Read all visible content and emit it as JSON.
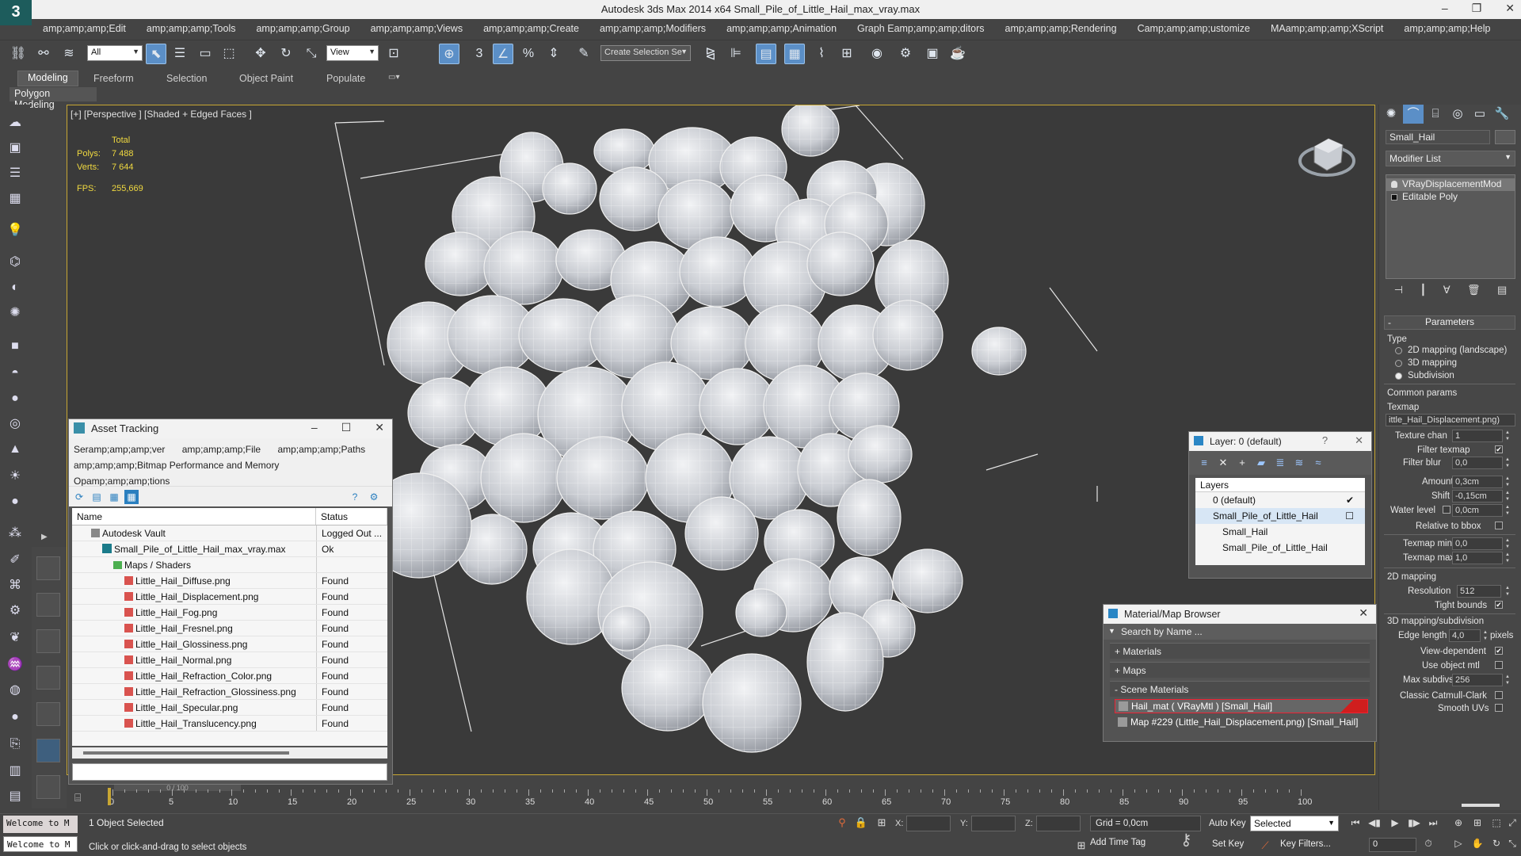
{
  "app": {
    "logo": "3",
    "title": "Autodesk 3ds Max  2014 x64     Small_Pile_of_Little_Hail_max_vray.max"
  },
  "menu": [
    "amp;amp;amp;Edit",
    "amp;amp;amp;Tools",
    "amp;amp;amp;Group",
    "amp;amp;amp;Views",
    "amp;amp;amp;Create",
    "amp;amp;amp;Modifiers",
    "amp;amp;amp;Animation",
    "Graph Eamp;amp;amp;ditors",
    "amp;amp;amp;Rendering",
    "Camp;amp;amp;ustomize",
    "MAamp;amp;amp;XScript",
    "amp;amp;amp;Help"
  ],
  "toolbar": {
    "filter": "All",
    "refcoord": "View",
    "selection_set": "Create Selection Se"
  },
  "ribbon": {
    "tabs": [
      "Modeling",
      "Freeform",
      "Selection",
      "Object Paint",
      "Populate"
    ],
    "subpanel": "Polygon Modeling"
  },
  "viewport": {
    "label": "[+] [Perspective ] [Shaded + Edged Faces ]",
    "stats_total": "Total",
    "polys_label": "Polys:",
    "polys": "7 488",
    "verts_label": "Verts:",
    "verts": "7 644",
    "fps_label": "FPS:",
    "fps": "255,669"
  },
  "asset_tracking": {
    "title": "Asset Tracking",
    "menus": [
      "Seramp;amp;amp;ver",
      "amp;amp;amp;File",
      "amp;amp;amp;Paths",
      "amp;amp;amp;Bitmap Performance and Memory",
      "Opamp;amp;amp;tions"
    ],
    "columns": [
      "Name",
      "Status"
    ],
    "rows": [
      {
        "name": "Autodesk Vault",
        "status": "Logged Out ..."
      },
      {
        "name": "Small_Pile_of_Little_Hail_max_vray.max",
        "status": "Ok"
      },
      {
        "name": "Maps / Shaders",
        "status": ""
      },
      {
        "name": "Little_Hail_Diffuse.png",
        "status": "Found"
      },
      {
        "name": "Little_Hail_Displacement.png",
        "status": "Found"
      },
      {
        "name": "Little_Hail_Fog.png",
        "status": "Found"
      },
      {
        "name": "Little_Hail_Fresnel.png",
        "status": "Found"
      },
      {
        "name": "Little_Hail_Glossiness.png",
        "status": "Found"
      },
      {
        "name": "Little_Hail_Normal.png",
        "status": "Found"
      },
      {
        "name": "Little_Hail_Refraction_Color.png",
        "status": "Found"
      },
      {
        "name": "Little_Hail_Refraction_Glossiness.png",
        "status": "Found"
      },
      {
        "name": "Little_Hail_Specular.png",
        "status": "Found"
      },
      {
        "name": "Little_Hail_Translucency.png",
        "status": "Found"
      }
    ]
  },
  "layer_dialog": {
    "title": "Layer: 0 (default)",
    "help": "?",
    "header": "Layers",
    "rows": [
      "0 (default)",
      "Small_Pile_of_Little_Hail",
      "Small_Hail",
      "Small_Pile_of_Little_Hail"
    ]
  },
  "material_browser": {
    "title": "Material/Map Browser",
    "search_placeholder": "Search by Name ...",
    "groups": [
      "+ Materials",
      "+ Maps",
      "- Scene Materials"
    ],
    "items": [
      "Hail_mat  ( VRayMtl ) [Small_Hail]",
      "Map #229 (Little_Hail_Displacement.png) [Small_Hail]"
    ]
  },
  "command_panel": {
    "object_name": "Small_Hail",
    "modifier_list": "Modifier List",
    "stack": [
      "VRayDisplacementMod",
      "Editable Poly"
    ],
    "rollout": "Parameters",
    "type_label": "Type",
    "type_options": [
      "2D mapping (landscape)",
      "3D mapping",
      "Subdivision"
    ],
    "common_params": "Common params",
    "texmap_label": "Texmap",
    "texmap_value": "ittle_Hail_Displacement.png)",
    "texture_chan_label": "Texture chan",
    "texture_chan": "1",
    "filter_texmap": "Filter texmap",
    "filter_blur_label": "Filter blur",
    "filter_blur": "0,0",
    "amount_label": "Amount",
    "amount": "0,3cm",
    "shift_label": "Shift",
    "shift": "-0,15cm",
    "water_level_label": "Water level",
    "water_level": "0,0cm",
    "relative_bbox": "Relative to bbox",
    "texmap_min_label": "Texmap min",
    "texmap_min": "0,0",
    "texmap_max_label": "Texmap max",
    "texmap_max": "1,0",
    "mapping2d": "2D mapping",
    "resolution_label": "Resolution",
    "resolution": "512",
    "tight_bounds": "Tight bounds",
    "mapping3d": "3D mapping/subdivision",
    "edge_length_label": "Edge length",
    "edge_length": "4,0",
    "pixels": "pixels",
    "view_dependent": "View-dependent",
    "use_object_mtl": "Use object mtl",
    "max_subdivs_label": "Max subdivs",
    "max_subdivs": "256",
    "classic_cc": "Classic Catmull-Clark",
    "smooth_uvs": "Smooth UVs"
  },
  "timeline": {
    "frame_slider": "0 / 100",
    "ticks": [
      "0",
      "5",
      "10",
      "15",
      "20",
      "25",
      "30",
      "35",
      "40",
      "45",
      "50",
      "55",
      "60",
      "65",
      "70",
      "75",
      "80",
      "85",
      "90",
      "95",
      "100"
    ]
  },
  "status": {
    "welcome": "Welcome to M",
    "selected": "1 Object Selected",
    "prompt": "Click or click-and-drag to select objects",
    "x_label": "X:",
    "y_label": "Y:",
    "z_label": "Z:",
    "grid": "Grid = 0,0cm",
    "add_time_tag": "Add Time Tag",
    "auto_key": "Auto Key",
    "set_key": "Set Key",
    "selected_mode": "Selected",
    "key_filters": "Key Filters...",
    "frame": "0"
  }
}
